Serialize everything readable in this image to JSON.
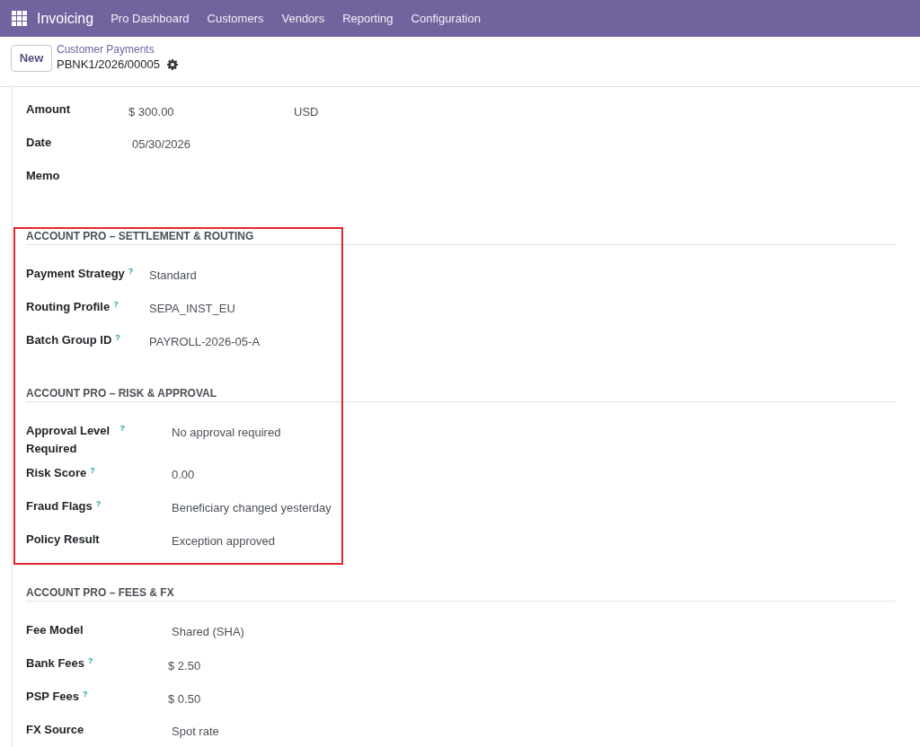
{
  "navbar": {
    "app_name": "Invoicing",
    "menu": [
      "Pro Dashboard",
      "Customers",
      "Vendors",
      "Reporting",
      "Configuration"
    ]
  },
  "control_panel": {
    "new_button": "New",
    "breadcrumb": "Customer Payments",
    "record_name": "PBNK1/2026/00005"
  },
  "main_fields": [
    {
      "label": "Amount",
      "kind": "monetary",
      "value": "$ 300.00",
      "currency": "USD"
    },
    {
      "label": "Date",
      "kind": "text",
      "value": "05/30/2026"
    },
    {
      "label": "Memo",
      "kind": "text"
    }
  ],
  "sections": [
    {
      "title": "ACCOUNT PRO – SETTLEMENT & ROUTING",
      "highlighted": true,
      "fields": [
        {
          "label": "Payment Strategy",
          "help": "?",
          "kind": "text",
          "value": "Standard"
        },
        {
          "label": "Routing Profile",
          "help": "?",
          "kind": "text",
          "value": "SEPA_INST_EU"
        },
        {
          "label": "Batch Group ID",
          "help": "?",
          "kind": "text",
          "value": "PAYROLL-2026-05-A"
        }
      ]
    },
    {
      "title": "ACCOUNT PRO – RISK & APPROVAL",
      "highlighted": true,
      "fields": [
        {
          "label": "Approval Level Required",
          "help": "?",
          "kind": "text",
          "value": "No approval required"
        },
        {
          "label": "Risk Score",
          "help": "?",
          "kind": "text",
          "value": "0.00"
        },
        {
          "label": "Fraud Flags",
          "help": "?",
          "kind": "text",
          "value": "Beneficiary changed yesterday"
        },
        {
          "label": "Policy Result",
          "kind": "text",
          "value": "Exception approved"
        }
      ]
    },
    {
      "title": "ACCOUNT PRO – FEES & FX",
      "highlighted": false,
      "fields": [
        {
          "label": "Fee Model",
          "kind": "text",
          "value": "Shared (SHA)"
        },
        {
          "label": "Bank Fees",
          "help": "?",
          "kind": "monetary",
          "value": "$ 2.50"
        },
        {
          "label": "PSP Fees",
          "help": "?",
          "kind": "monetary",
          "value": "$ 0.50"
        },
        {
          "label": "FX Source",
          "kind": "text",
          "value": "Spot rate"
        }
      ]
    }
  ]
}
